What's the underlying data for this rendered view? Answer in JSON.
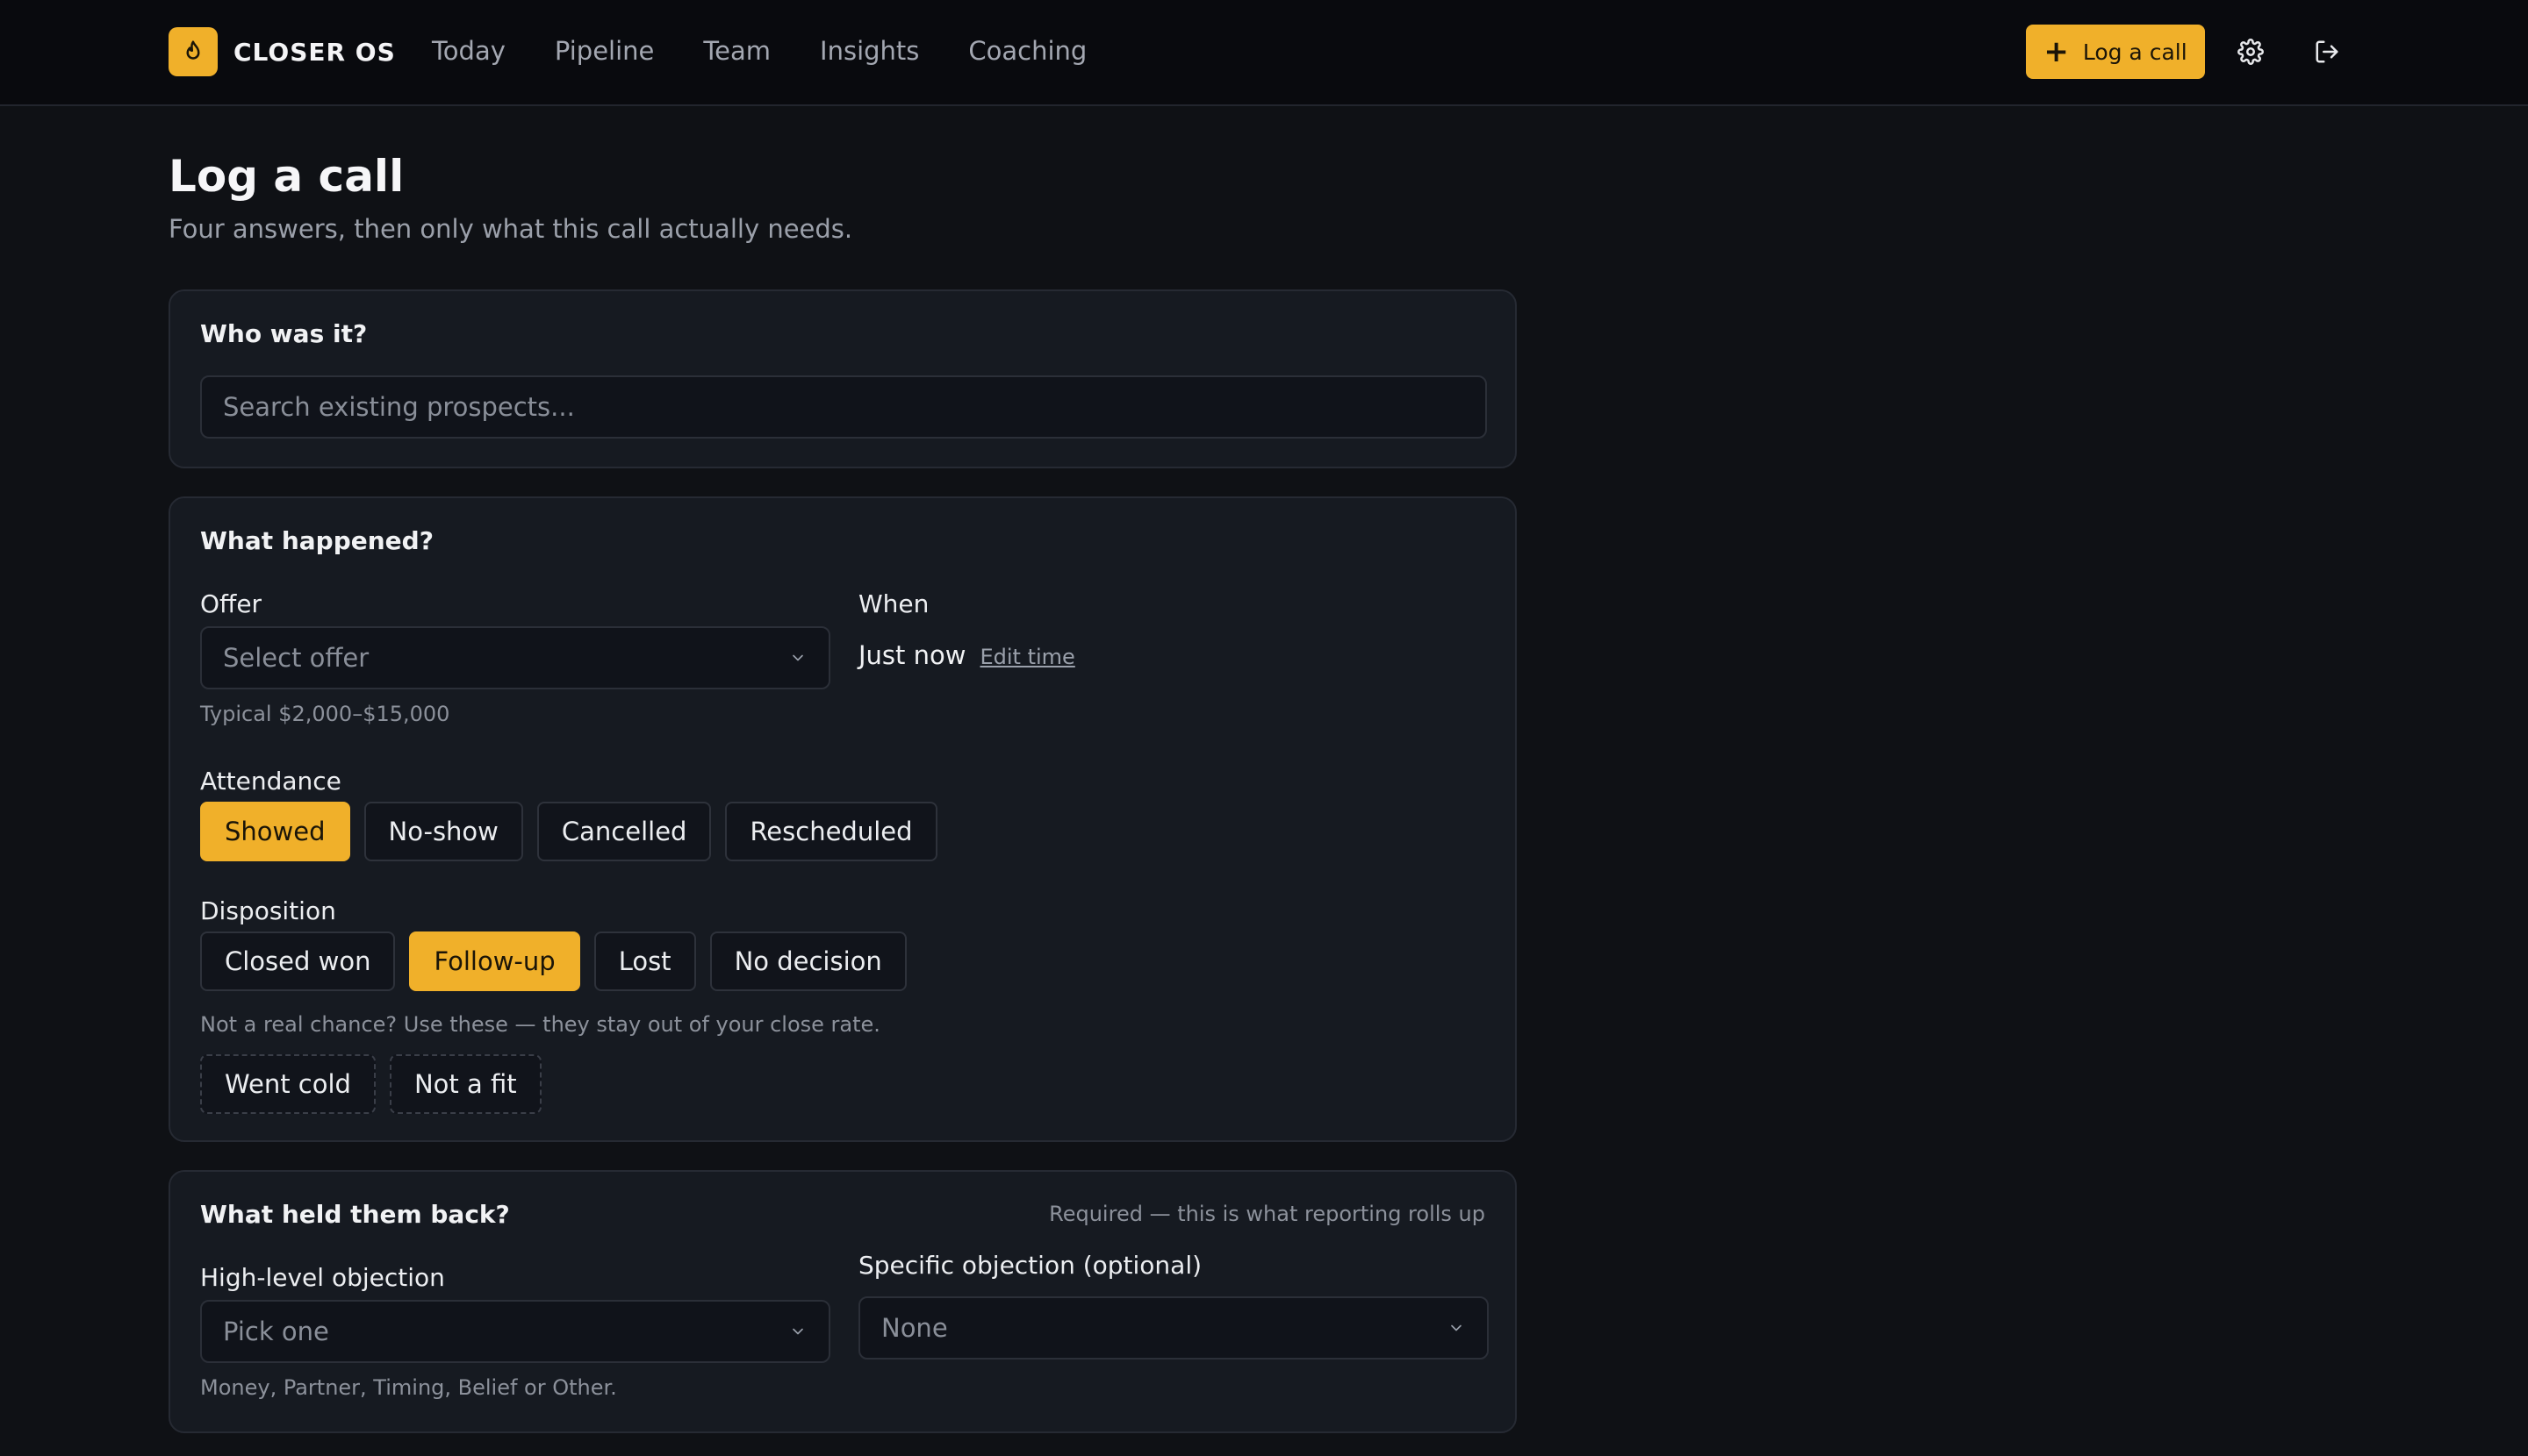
{
  "app": {
    "brand": "CLOSER OS",
    "accent_color": "#f0b02a"
  },
  "nav": {
    "items": [
      "Today",
      "Pipeline",
      "Team",
      "Insights",
      "Coaching"
    ],
    "log_call_label": "Log a call"
  },
  "page": {
    "title": "Log a call",
    "subtitle": "Four answers, then only what this call actually needs."
  },
  "who": {
    "title": "Who was it?",
    "search_placeholder": "Search existing prospects..."
  },
  "what": {
    "title": "What happened?",
    "offer_label": "Offer",
    "offer_placeholder": "Select offer",
    "offer_hint": "Typical $2,000–$15,000",
    "when_label": "When",
    "when_value": "Just now",
    "edit_time": "Edit time",
    "attendance_label": "Attendance",
    "attendance_options": [
      "Showed",
      "No-show",
      "Cancelled",
      "Rescheduled"
    ],
    "attendance_selected": "Showed",
    "disposition_label": "Disposition",
    "disposition_options": [
      "Closed won",
      "Follow-up",
      "Lost",
      "No decision"
    ],
    "disposition_selected": "Follow-up",
    "not_real_hint": "Not a real chance? Use these — they stay out of your close rate.",
    "not_real_options": [
      "Went cold",
      "Not a fit"
    ]
  },
  "held": {
    "title": "What held them back?",
    "required_note": "Required — this is what reporting rolls up",
    "high_level_label": "High-level objection",
    "high_level_placeholder": "Pick one",
    "high_level_hint": "Money, Partner, Timing, Belief or Other.",
    "specific_label": "Specific objection (optional)",
    "specific_value": "None"
  }
}
